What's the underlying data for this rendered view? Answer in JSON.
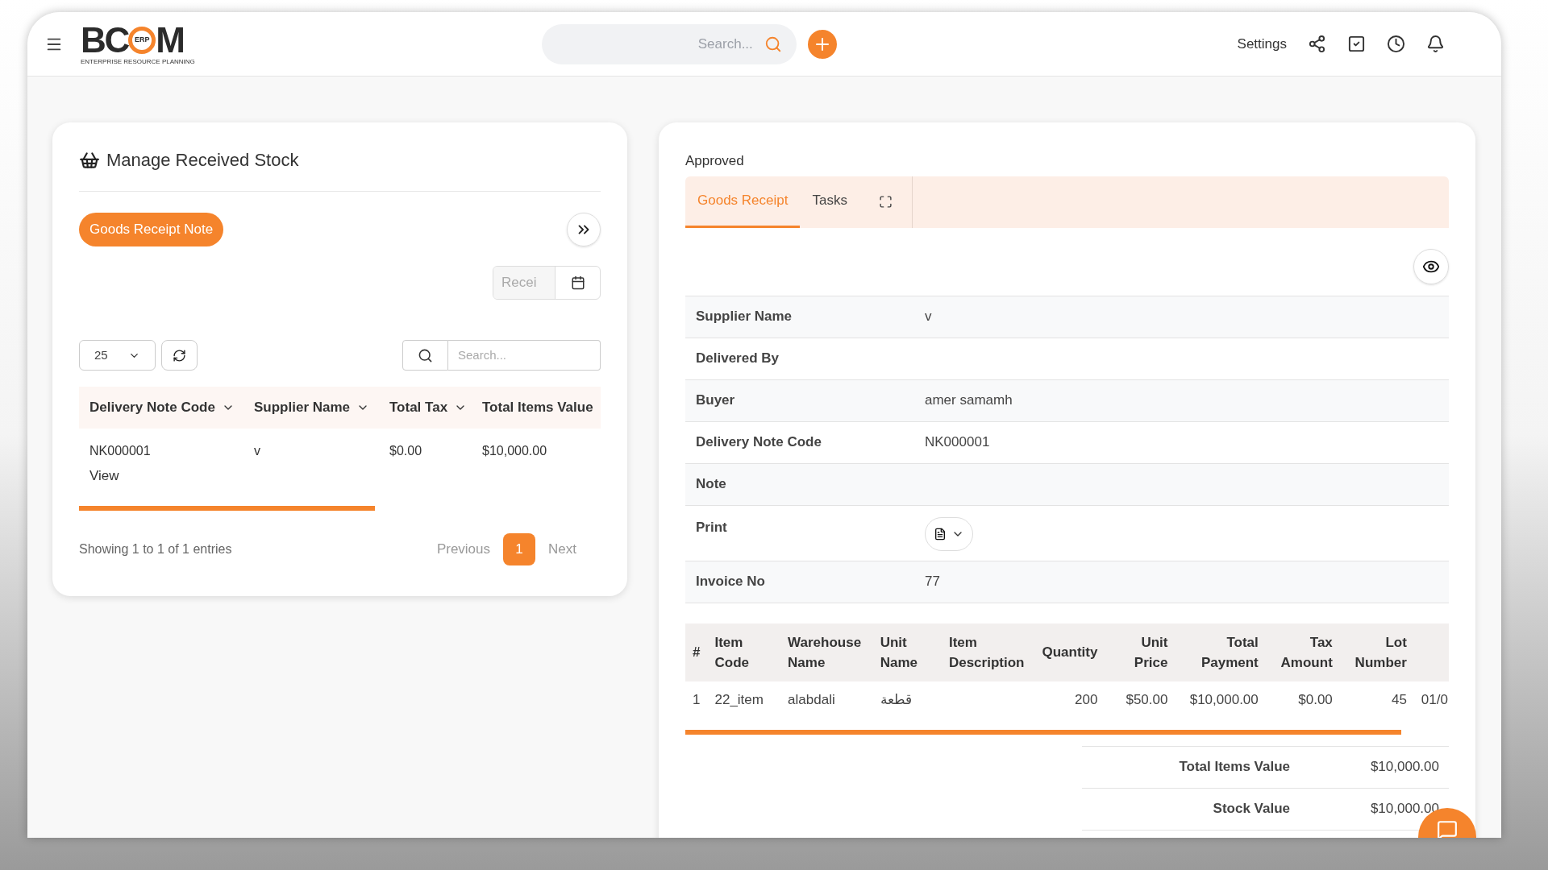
{
  "header": {
    "logo": {
      "left": "BC",
      "badge": "ERP",
      "right": "M",
      "tagline": "ENTERPRISE RESOURCE PLANNING"
    },
    "search": {
      "placeholder": "Search..."
    },
    "settings": "Settings"
  },
  "left_panel": {
    "title": "Manage Received Stock",
    "new_button": "Goods Receipt Note",
    "date_filter": {
      "placeholder": "Recei"
    },
    "page_size": "25",
    "search": {
      "placeholder": "Search..."
    },
    "table": {
      "columns": [
        "Delivery Note Code",
        "Supplier Name",
        "Total Tax",
        "Total Items Value"
      ],
      "rows": [
        {
          "cells": [
            "NK000001",
            "v",
            "$0.00",
            "$10,000.00"
          ],
          "link": "View"
        }
      ]
    },
    "footer": "Showing 1 to 1 of 1 entries",
    "pagination": {
      "previous": "Previous",
      "pages": [
        {
          "label": "1",
          "selected": true
        }
      ],
      "next": "Next"
    }
  },
  "right_panel": {
    "status": "Approved",
    "tabs": [
      {
        "label": "Goods Receipt",
        "selected": true
      },
      {
        "label": "Tasks",
        "selected": false
      }
    ],
    "details": [
      {
        "label": "Supplier Name",
        "value": "v",
        "kind": "text"
      },
      {
        "label": "Delivered By",
        "kind": "text"
      },
      {
        "label": "Buyer",
        "value": "amer samamh",
        "kind": "text"
      },
      {
        "label": "Delivery Note Code",
        "value": "NK000001",
        "kind": "text"
      },
      {
        "label": "Note",
        "kind": "text"
      },
      {
        "label": "Print",
        "kind": "print"
      },
      {
        "label": "Invoice No",
        "value": "77",
        "kind": "text"
      }
    ],
    "items": {
      "columns": [
        "#",
        "Item Code",
        "Warehouse Name",
        "Unit Name",
        "Item Description",
        "Quantity",
        "Unit Price",
        "Total Payment",
        "Tax Amount",
        "Lot Number"
      ],
      "rows": [
        [
          "1",
          "22_item",
          "alabdali",
          "قطعة",
          "",
          "200",
          "$50.00",
          "$10,000.00",
          "$0.00",
          "45",
          "01/0"
        ]
      ]
    },
    "totals": [
      {
        "label": "Total Items Value",
        "value": "$10,000.00"
      },
      {
        "label": "Stock Value",
        "value": "$10,000.00"
      }
    ]
  }
}
